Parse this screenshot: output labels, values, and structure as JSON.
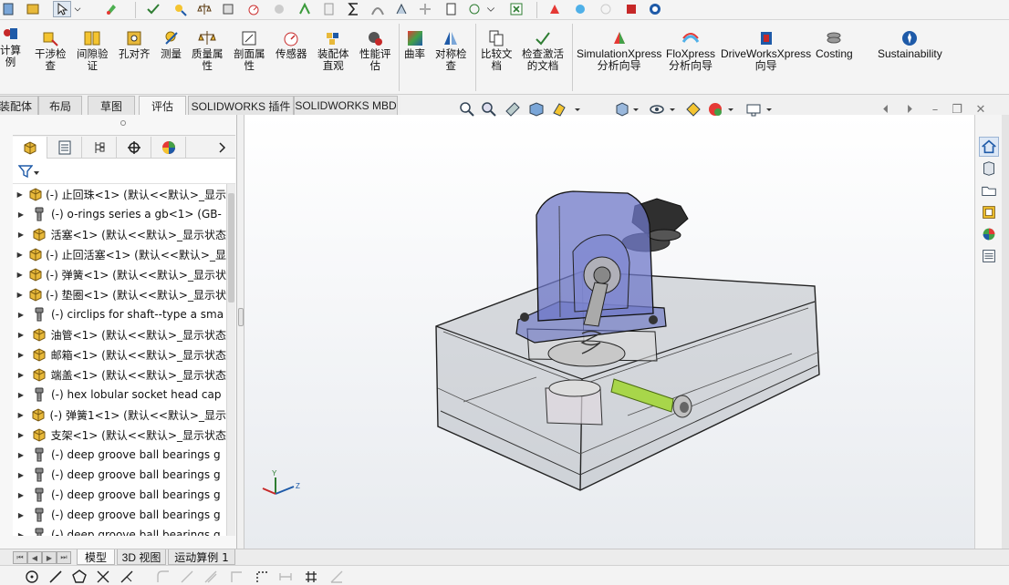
{
  "command_manager": {
    "items": [
      {
        "label": "计算\n例",
        "icon": "calc-icon"
      },
      {
        "label": "干涉检\n查",
        "icon": "interference-check-icon"
      },
      {
        "label": "间隙验\n证",
        "icon": "clearance-icon"
      },
      {
        "label": "孔对齐",
        "icon": "hole-align-icon"
      },
      {
        "label": "测量",
        "icon": "measure-icon"
      },
      {
        "label": "质量属\n性",
        "icon": "mass-properties-icon"
      },
      {
        "label": "剖面属\n性",
        "icon": "section-properties-icon"
      },
      {
        "label": "传感器",
        "icon": "sensor-icon"
      },
      {
        "label": "装配体\n直观",
        "icon": "assembly-visualization-icon"
      },
      {
        "label": "性能评\n估",
        "icon": "performance-icon"
      },
      {
        "label": "曲率",
        "icon": "curvature-icon"
      },
      {
        "label": "对称检\n查",
        "icon": "symmetry-icon"
      },
      {
        "label": "比较文\n档",
        "icon": "compare-icon"
      },
      {
        "label": "检查激活\n的文档",
        "icon": "check-document-icon"
      },
      {
        "label": "SimulationXpress\n分析向导",
        "icon": "simulationxpress-icon"
      },
      {
        "label": "FloXpress\n分析向导",
        "icon": "floxpress-icon"
      },
      {
        "label": "DriveWorksXpress\n向导",
        "icon": "driveworks-icon"
      },
      {
        "label": "Costing",
        "icon": "costing-icon"
      },
      {
        "label": "Sustainability",
        "icon": "sustainability-icon"
      }
    ]
  },
  "tabs": [
    {
      "label": "装配体"
    },
    {
      "label": "布局"
    },
    {
      "label": "草图"
    },
    {
      "label": "评估"
    },
    {
      "label": "SOLIDWORKS 插件"
    },
    {
      "label": "SOLIDWORKS MBD"
    }
  ],
  "tree": {
    "rows": [
      {
        "label": "(-) 止回珠<1> (默认<<默认>_显示",
        "icon": "part-icon"
      },
      {
        "label": "(-) o-rings series a gb<1> (GB-",
        "icon": "toolbox-part-icon"
      },
      {
        "label": "活塞<1> (默认<<默认>_显示状态",
        "icon": "part-icon"
      },
      {
        "label": "(-) 止回活塞<1> (默认<<默认>_显",
        "icon": "part-icon"
      },
      {
        "label": "(-) 弹簧<1> (默认<<默认>_显示状",
        "icon": "part-icon"
      },
      {
        "label": "(-) 垫圈<1> (默认<<默认>_显示状",
        "icon": "part-icon"
      },
      {
        "label": "(-) circlips for shaft--type a sma",
        "icon": "toolbox-part-icon"
      },
      {
        "label": "油管<1> (默认<<默认>_显示状态",
        "icon": "part-icon"
      },
      {
        "label": "邮箱<1> (默认<<默认>_显示状态",
        "icon": "part-icon"
      },
      {
        "label": "端盖<1> (默认<<默认>_显示状态",
        "icon": "part-icon"
      },
      {
        "label": "(-) hex lobular socket head cap",
        "icon": "toolbox-part-icon"
      },
      {
        "label": "(-) 弹簧1<1> (默认<<默认>_显示",
        "icon": "part-icon"
      },
      {
        "label": "支架<1> (默认<<默认>_显示状态",
        "icon": "part-icon"
      },
      {
        "label": "(-) deep groove ball bearings g",
        "icon": "toolbox-part-icon"
      },
      {
        "label": "(-) deep groove ball bearings g",
        "icon": "toolbox-part-icon"
      },
      {
        "label": "(-) deep groove ball bearings g",
        "icon": "toolbox-part-icon"
      },
      {
        "label": "(-) deep groove ball bearings g",
        "icon": "toolbox-part-icon"
      },
      {
        "label": "(-) deep groove ball bearings g",
        "icon": "toolbox-part-icon"
      }
    ]
  },
  "bottom_tabs": [
    {
      "label": "模型"
    },
    {
      "label": "3D 视图"
    },
    {
      "label": "运动算例 1"
    }
  ],
  "colors": {
    "accent": "#1e5aa8",
    "part_yellow": "#e8b93a",
    "housing_blue": "#6f78c8",
    "tube_green": "#9acd32"
  }
}
